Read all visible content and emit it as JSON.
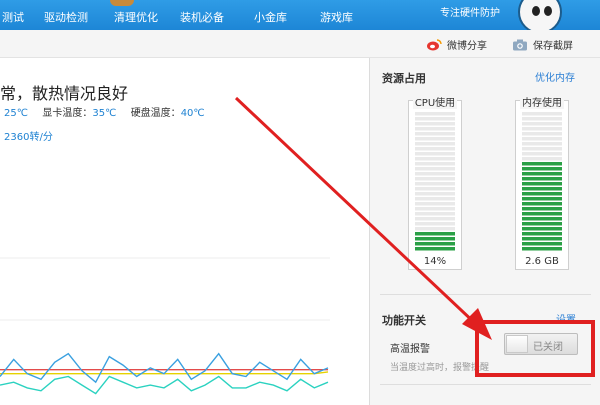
{
  "nav": {
    "items": [
      "测试",
      "驱动检测",
      "清理优化",
      "装机必备",
      "小金库",
      "游戏库"
    ],
    "slogan": "专注硬件防护"
  },
  "toolbar": {
    "weibo_share": "微博分享",
    "save_screenshot": "保存截屏"
  },
  "status": {
    "headline": "常，散热情况良好",
    "cpu_temp": "25℃",
    "gpu_temp_label": "显卡温度：",
    "gpu_temp": "35℃",
    "disk_temp_label": "硬盘温度：",
    "disk_temp": "40℃",
    "fan_speed": "2360转/分"
  },
  "resources": {
    "title": "资源占用",
    "optimize_link": "优化内存",
    "cpu_label": "CPU使用",
    "cpu_value": "14%",
    "cpu_fraction": 0.14,
    "mem_label": "内存使用",
    "mem_value": "2.6 GB",
    "mem_fraction": 0.66
  },
  "features": {
    "title": "功能开关",
    "settings_link": "设置",
    "high_temp_alarm_label": "高温报警",
    "toggle_state": "已关闭",
    "hint": "当温度过高时，报警提醒"
  },
  "colors": {
    "nav_bg": "#1d86d6",
    "accent_blue": "#1f82d2",
    "meter_green": "#2aa046",
    "annotation_red": "#e02020"
  },
  "chart_data": {
    "type": "line",
    "series": [
      {
        "color": "#e34b4b",
        "values": [
          0.62,
          0.62,
          0.62,
          0.62,
          0.62,
          0.62,
          0.62,
          0.62,
          0.62,
          0.62,
          0.62,
          0.62,
          0.62,
          0.62,
          0.62,
          0.62,
          0.62,
          0.62,
          0.62,
          0.62,
          0.62,
          0.62,
          0.62,
          0.62,
          0.62
        ]
      },
      {
        "color": "#e6d200",
        "values": [
          0.55,
          0.55,
          0.55,
          0.55,
          0.55,
          0.55,
          0.55,
          0.55,
          0.55,
          0.55,
          0.55,
          0.55,
          0.55,
          0.55,
          0.55,
          0.55,
          0.55,
          0.55,
          0.55,
          0.55,
          0.55,
          0.55,
          0.55,
          0.55,
          0.58
        ]
      },
      {
        "color": "#3aa0e0",
        "values": [
          0.5,
          0.8,
          0.55,
          0.45,
          0.75,
          0.9,
          0.6,
          0.4,
          0.85,
          0.7,
          0.5,
          0.65,
          0.55,
          0.8,
          0.45,
          0.6,
          0.9,
          0.55,
          0.5,
          0.75,
          0.6,
          0.45,
          0.8,
          0.55,
          0.65
        ]
      },
      {
        "color": "#2bd2c0",
        "values": [
          0.35,
          0.4,
          0.3,
          0.25,
          0.45,
          0.5,
          0.35,
          0.2,
          0.5,
          0.4,
          0.3,
          0.35,
          0.3,
          0.45,
          0.25,
          0.35,
          0.5,
          0.3,
          0.3,
          0.4,
          0.35,
          0.25,
          0.45,
          0.3,
          0.4
        ]
      }
    ]
  }
}
